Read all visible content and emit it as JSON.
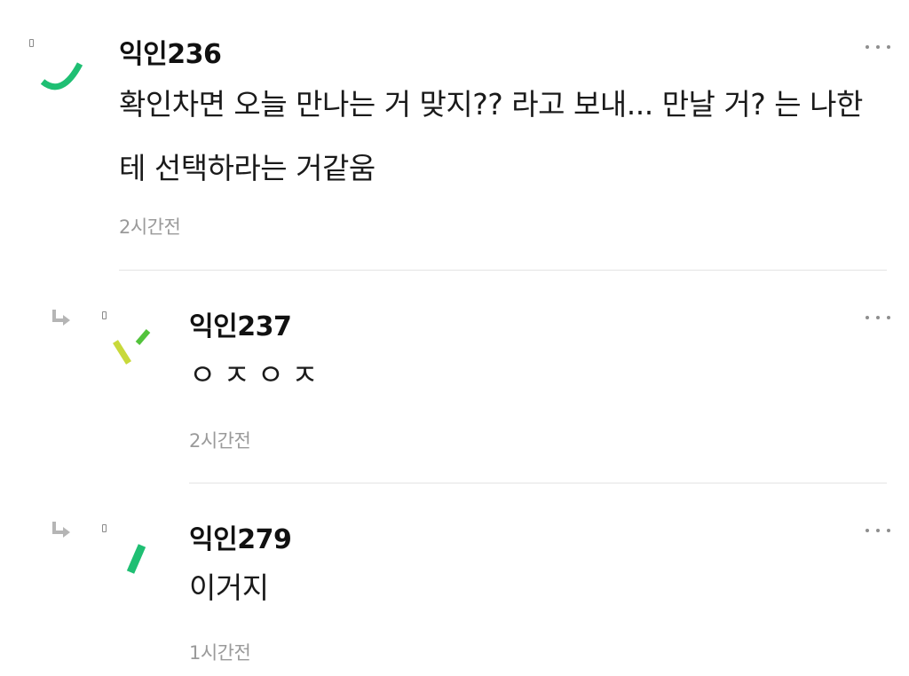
{
  "comments": [
    {
      "nickname": "익인236",
      "text": "확인차면 오늘 만나는 거 맞지?? 라고 보내... 만날 거? 는 나한테 선택하라는 거같움",
      "time": "2시간전",
      "is_reply": false
    },
    {
      "nickname": "익인237",
      "text": "ㅇㅈㅇㅈ",
      "time": "2시간전",
      "is_reply": true
    },
    {
      "nickname": "익인279",
      "text": "이거지",
      "time": "1시간전",
      "is_reply": true
    }
  ],
  "colors": {
    "green": "#1fbf73",
    "lime": "#c8d93a",
    "meta": "#9a9a9a",
    "divider": "#e4e4e4"
  },
  "icons": {
    "reply": "reply-arrow-icon",
    "more": "more-options-icon",
    "badge": "user-badge-icon"
  }
}
